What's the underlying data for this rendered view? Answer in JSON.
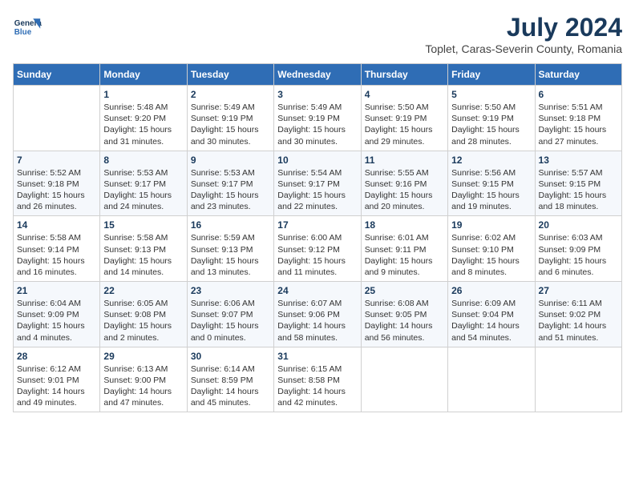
{
  "brand": {
    "line1": "General",
    "line2": "Blue"
  },
  "title": "July 2024",
  "subtitle": "Toplet, Caras-Severin County, Romania",
  "days_of_week": [
    "Sunday",
    "Monday",
    "Tuesday",
    "Wednesday",
    "Thursday",
    "Friday",
    "Saturday"
  ],
  "weeks": [
    [
      {
        "num": "",
        "info": ""
      },
      {
        "num": "1",
        "info": "Sunrise: 5:48 AM\nSunset: 9:20 PM\nDaylight: 15 hours\nand 31 minutes."
      },
      {
        "num": "2",
        "info": "Sunrise: 5:49 AM\nSunset: 9:19 PM\nDaylight: 15 hours\nand 30 minutes."
      },
      {
        "num": "3",
        "info": "Sunrise: 5:49 AM\nSunset: 9:19 PM\nDaylight: 15 hours\nand 30 minutes."
      },
      {
        "num": "4",
        "info": "Sunrise: 5:50 AM\nSunset: 9:19 PM\nDaylight: 15 hours\nand 29 minutes."
      },
      {
        "num": "5",
        "info": "Sunrise: 5:50 AM\nSunset: 9:19 PM\nDaylight: 15 hours\nand 28 minutes."
      },
      {
        "num": "6",
        "info": "Sunrise: 5:51 AM\nSunset: 9:18 PM\nDaylight: 15 hours\nand 27 minutes."
      }
    ],
    [
      {
        "num": "7",
        "info": "Sunrise: 5:52 AM\nSunset: 9:18 PM\nDaylight: 15 hours\nand 26 minutes."
      },
      {
        "num": "8",
        "info": "Sunrise: 5:53 AM\nSunset: 9:17 PM\nDaylight: 15 hours\nand 24 minutes."
      },
      {
        "num": "9",
        "info": "Sunrise: 5:53 AM\nSunset: 9:17 PM\nDaylight: 15 hours\nand 23 minutes."
      },
      {
        "num": "10",
        "info": "Sunrise: 5:54 AM\nSunset: 9:17 PM\nDaylight: 15 hours\nand 22 minutes."
      },
      {
        "num": "11",
        "info": "Sunrise: 5:55 AM\nSunset: 9:16 PM\nDaylight: 15 hours\nand 20 minutes."
      },
      {
        "num": "12",
        "info": "Sunrise: 5:56 AM\nSunset: 9:15 PM\nDaylight: 15 hours\nand 19 minutes."
      },
      {
        "num": "13",
        "info": "Sunrise: 5:57 AM\nSunset: 9:15 PM\nDaylight: 15 hours\nand 18 minutes."
      }
    ],
    [
      {
        "num": "14",
        "info": "Sunrise: 5:58 AM\nSunset: 9:14 PM\nDaylight: 15 hours\nand 16 minutes."
      },
      {
        "num": "15",
        "info": "Sunrise: 5:58 AM\nSunset: 9:13 PM\nDaylight: 15 hours\nand 14 minutes."
      },
      {
        "num": "16",
        "info": "Sunrise: 5:59 AM\nSunset: 9:13 PM\nDaylight: 15 hours\nand 13 minutes."
      },
      {
        "num": "17",
        "info": "Sunrise: 6:00 AM\nSunset: 9:12 PM\nDaylight: 15 hours\nand 11 minutes."
      },
      {
        "num": "18",
        "info": "Sunrise: 6:01 AM\nSunset: 9:11 PM\nDaylight: 15 hours\nand 9 minutes."
      },
      {
        "num": "19",
        "info": "Sunrise: 6:02 AM\nSunset: 9:10 PM\nDaylight: 15 hours\nand 8 minutes."
      },
      {
        "num": "20",
        "info": "Sunrise: 6:03 AM\nSunset: 9:09 PM\nDaylight: 15 hours\nand 6 minutes."
      }
    ],
    [
      {
        "num": "21",
        "info": "Sunrise: 6:04 AM\nSunset: 9:09 PM\nDaylight: 15 hours\nand 4 minutes."
      },
      {
        "num": "22",
        "info": "Sunrise: 6:05 AM\nSunset: 9:08 PM\nDaylight: 15 hours\nand 2 minutes."
      },
      {
        "num": "23",
        "info": "Sunrise: 6:06 AM\nSunset: 9:07 PM\nDaylight: 15 hours\nand 0 minutes."
      },
      {
        "num": "24",
        "info": "Sunrise: 6:07 AM\nSunset: 9:06 PM\nDaylight: 14 hours\nand 58 minutes."
      },
      {
        "num": "25",
        "info": "Sunrise: 6:08 AM\nSunset: 9:05 PM\nDaylight: 14 hours\nand 56 minutes."
      },
      {
        "num": "26",
        "info": "Sunrise: 6:09 AM\nSunset: 9:04 PM\nDaylight: 14 hours\nand 54 minutes."
      },
      {
        "num": "27",
        "info": "Sunrise: 6:11 AM\nSunset: 9:02 PM\nDaylight: 14 hours\nand 51 minutes."
      }
    ],
    [
      {
        "num": "28",
        "info": "Sunrise: 6:12 AM\nSunset: 9:01 PM\nDaylight: 14 hours\nand 49 minutes."
      },
      {
        "num": "29",
        "info": "Sunrise: 6:13 AM\nSunset: 9:00 PM\nDaylight: 14 hours\nand 47 minutes."
      },
      {
        "num": "30",
        "info": "Sunrise: 6:14 AM\nSunset: 8:59 PM\nDaylight: 14 hours\nand 45 minutes."
      },
      {
        "num": "31",
        "info": "Sunrise: 6:15 AM\nSunset: 8:58 PM\nDaylight: 14 hours\nand 42 minutes."
      },
      {
        "num": "",
        "info": ""
      },
      {
        "num": "",
        "info": ""
      },
      {
        "num": "",
        "info": ""
      }
    ]
  ]
}
